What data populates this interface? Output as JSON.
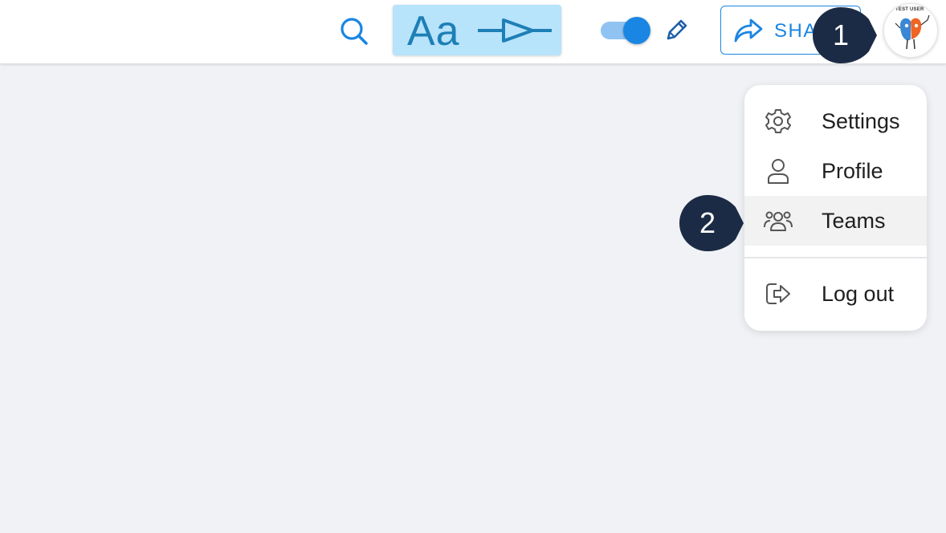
{
  "toolbar": {
    "text_style_label": "Aa",
    "share_label": "SHARE"
  },
  "avatar": {
    "tag": "TEST USER"
  },
  "badges": {
    "step1": "1",
    "step2": "2"
  },
  "menu": {
    "items": [
      {
        "label": "Settings",
        "icon": "gear-icon"
      },
      {
        "label": "Profile",
        "icon": "user-icon"
      },
      {
        "label": "Teams",
        "icon": "team-icon",
        "active": true
      },
      {
        "label": "Log out",
        "icon": "logout-icon"
      }
    ]
  },
  "colors": {
    "accent": "#1a86e3",
    "highlight": "#b7e3fb",
    "badge": "#1c2b45",
    "background": "#f0f2f5"
  }
}
